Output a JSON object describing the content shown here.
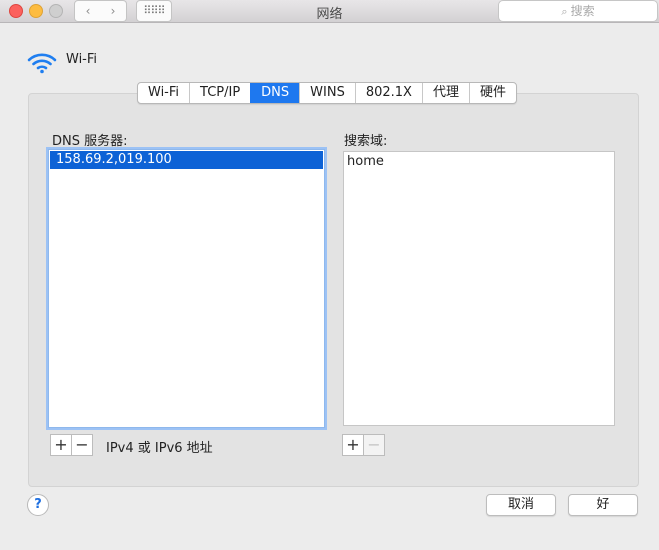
{
  "window": {
    "title": "网络",
    "back_icon": "‹",
    "forward_icon": "›",
    "grid_icon": "⠿⠿⠿",
    "search_placeholder": "搜索",
    "search_icon": "⌕"
  },
  "service": {
    "label": "Wi-Fi",
    "icon": "wifi-icon"
  },
  "tabs": [
    {
      "label": "Wi-Fi",
      "active": false
    },
    {
      "label": "TCP/IP",
      "active": false
    },
    {
      "label": "DNS",
      "active": true
    },
    {
      "label": "WINS",
      "active": false
    },
    {
      "label": "802.1X",
      "active": false
    },
    {
      "label": "代理",
      "active": false
    },
    {
      "label": "硬件",
      "active": false
    }
  ],
  "dns": {
    "heading": "DNS 服务器:",
    "servers": [
      "158.69.2,019.100"
    ],
    "hint": "IPv4 或 IPv6 地址"
  },
  "search_domains": {
    "heading": "搜索域:",
    "domains": [
      "home"
    ]
  },
  "controls": {
    "add": "+",
    "remove": "−"
  },
  "footer": {
    "help": "?",
    "cancel": "取消",
    "ok": "好"
  },
  "colors": {
    "accent": "#1e78ef",
    "selection": "#0d62d6"
  }
}
